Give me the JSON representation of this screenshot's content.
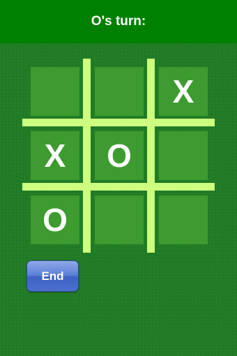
{
  "header": {
    "title": "O's turn:"
  },
  "board": {
    "cells": [
      {
        "mark": ""
      },
      {
        "mark": ""
      },
      {
        "mark": "X"
      },
      {
        "mark": "X"
      },
      {
        "mark": "O"
      },
      {
        "mark": ""
      },
      {
        "mark": "O"
      },
      {
        "mark": ""
      },
      {
        "mark": ""
      }
    ]
  },
  "controls": {
    "end_label": "End"
  },
  "colors": {
    "header": "#008000",
    "felt": "#1e7a22",
    "cell": "#3d9b2f",
    "grid_line": "#ccff80",
    "button": "#4b6fcf"
  }
}
